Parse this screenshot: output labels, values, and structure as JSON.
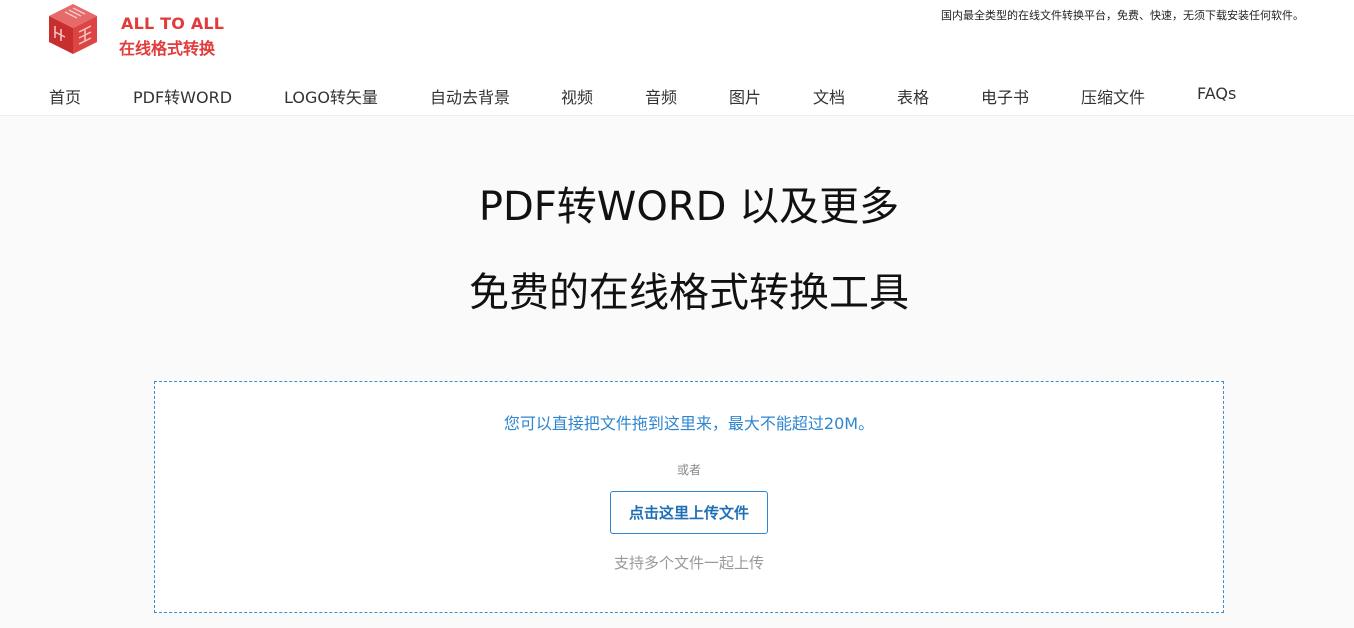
{
  "header": {
    "logo_en": "ALL TO ALL",
    "logo_cn": "在线格式转换",
    "tagline": "国内最全类型的在线文件转换平台，免费、快速，无须下载安装任何软件。",
    "brand_color": "#e23b3b"
  },
  "nav": {
    "items": [
      {
        "label": "首页"
      },
      {
        "label": "PDF转WORD"
      },
      {
        "label": "LOGO转矢量"
      },
      {
        "label": "自动去背景"
      },
      {
        "label": "视频"
      },
      {
        "label": "音频"
      },
      {
        "label": "图片"
      },
      {
        "label": "文档"
      },
      {
        "label": "表格"
      },
      {
        "label": "电子书"
      },
      {
        "label": "压缩文件"
      },
      {
        "label": "FAQs"
      }
    ]
  },
  "hero": {
    "title_line1": "PDF转WORD 以及更多",
    "title_line2": "免费的在线格式转换工具"
  },
  "upload": {
    "drop_hint": "您可以直接把文件拖到这里来，最大不能超过20M。",
    "or_text": "或者",
    "button_label": "点击这里上传文件",
    "multi_hint": "支持多个文件一起上传",
    "accent_color": "#2f86cf"
  },
  "icons": {
    "logo": "cube-logo-icon"
  }
}
